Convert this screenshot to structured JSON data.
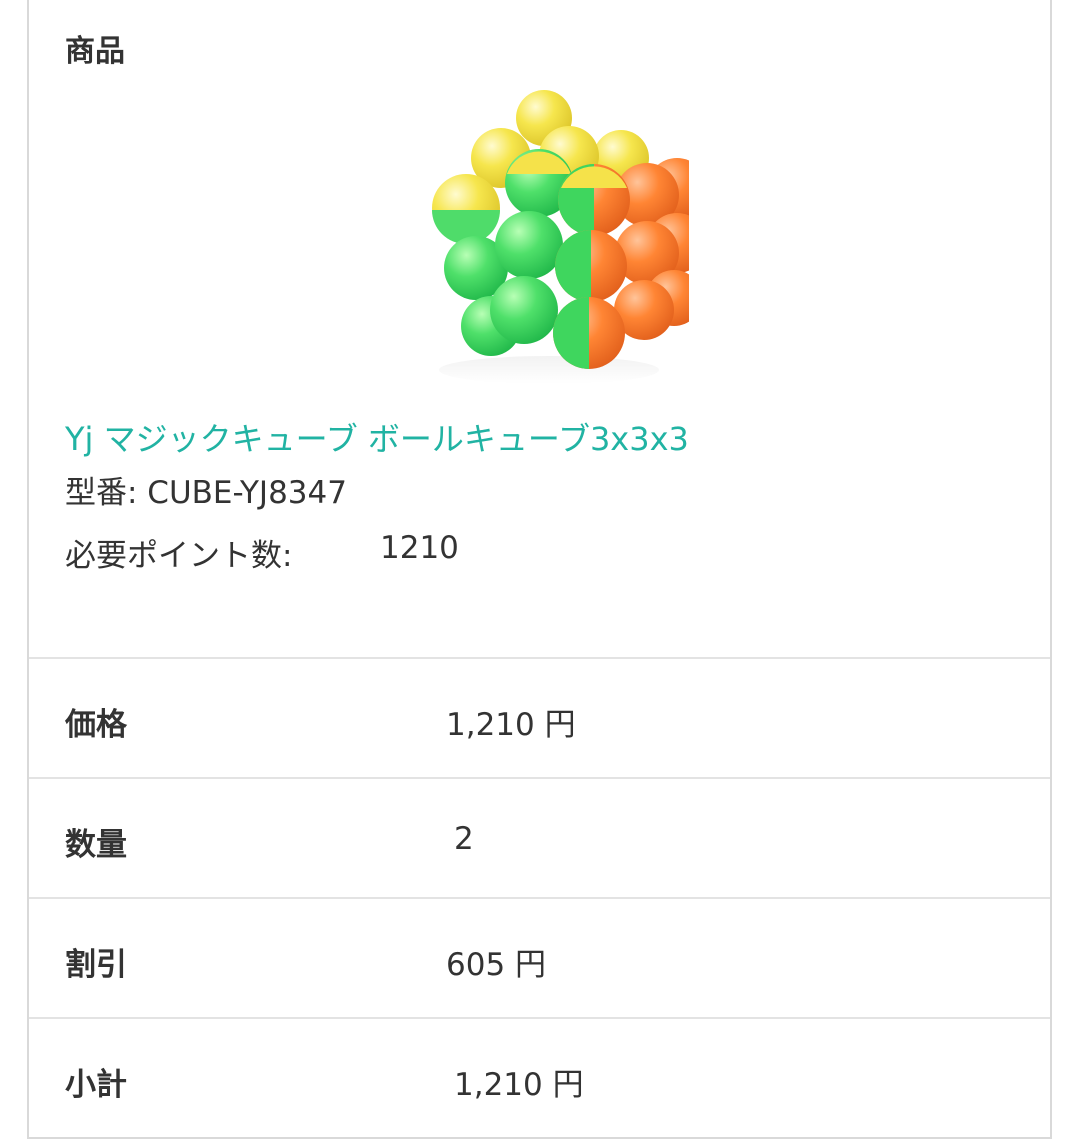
{
  "product": {
    "header": "商品",
    "image_alt": "ball-cube-photo",
    "name": "Yj マジックキューブ ボールキューブ3x3x3",
    "model_line": "型番: CUBE-YJ8347",
    "points_label": "必要ポイント数:",
    "points_value": "1210"
  },
  "rows": [
    {
      "label": "価格",
      "value": "1,210 円"
    },
    {
      "label": "数量",
      "value": "2"
    },
    {
      "label": "割引",
      "value": "605 円"
    },
    {
      "label": "小計",
      "value": "1,210 円"
    }
  ],
  "colors": {
    "link": "#21b3a3",
    "text": "#333333",
    "border": "#d9d9d9",
    "cube_green": "#4fdc6a",
    "cube_orange": "#ff7f2a",
    "cube_yellow": "#f5e24a"
  }
}
